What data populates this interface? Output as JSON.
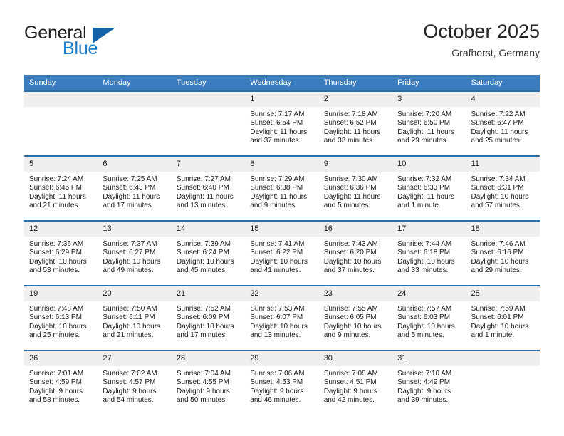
{
  "brand": {
    "line1": "General",
    "line2": "Blue",
    "logo_icon": "blue-triangle-logo",
    "color_dark": "#231f20",
    "color_blue": "#1e7bc4",
    "color_triangle": "#1462a5"
  },
  "header": {
    "title": "October 2025",
    "subtitle": "Grafhorst, Germany"
  },
  "theme": {
    "header_row_bg": "#3a7cbe",
    "row_border": "#2e6da4",
    "daynum_bg": "#efefef",
    "text": "#1a1a1a"
  },
  "weekday_headers": [
    "Sunday",
    "Monday",
    "Tuesday",
    "Wednesday",
    "Thursday",
    "Friday",
    "Saturday"
  ],
  "weeks": [
    [
      {
        "day": "",
        "sunrise": "",
        "sunset": "",
        "daylight": "",
        "empty": true
      },
      {
        "day": "",
        "sunrise": "",
        "sunset": "",
        "daylight": "",
        "empty": true
      },
      {
        "day": "",
        "sunrise": "",
        "sunset": "",
        "daylight": "",
        "empty": true
      },
      {
        "day": "1",
        "sunrise": "Sunrise: 7:17 AM",
        "sunset": "Sunset: 6:54 PM",
        "daylight": "Daylight: 11 hours and 37 minutes."
      },
      {
        "day": "2",
        "sunrise": "Sunrise: 7:18 AM",
        "sunset": "Sunset: 6:52 PM",
        "daylight": "Daylight: 11 hours and 33 minutes."
      },
      {
        "day": "3",
        "sunrise": "Sunrise: 7:20 AM",
        "sunset": "Sunset: 6:50 PM",
        "daylight": "Daylight: 11 hours and 29 minutes."
      },
      {
        "day": "4",
        "sunrise": "Sunrise: 7:22 AM",
        "sunset": "Sunset: 6:47 PM",
        "daylight": "Daylight: 11 hours and 25 minutes."
      }
    ],
    [
      {
        "day": "5",
        "sunrise": "Sunrise: 7:24 AM",
        "sunset": "Sunset: 6:45 PM",
        "daylight": "Daylight: 11 hours and 21 minutes."
      },
      {
        "day": "6",
        "sunrise": "Sunrise: 7:25 AM",
        "sunset": "Sunset: 6:43 PM",
        "daylight": "Daylight: 11 hours and 17 minutes."
      },
      {
        "day": "7",
        "sunrise": "Sunrise: 7:27 AM",
        "sunset": "Sunset: 6:40 PM",
        "daylight": "Daylight: 11 hours and 13 minutes."
      },
      {
        "day": "8",
        "sunrise": "Sunrise: 7:29 AM",
        "sunset": "Sunset: 6:38 PM",
        "daylight": "Daylight: 11 hours and 9 minutes."
      },
      {
        "day": "9",
        "sunrise": "Sunrise: 7:30 AM",
        "sunset": "Sunset: 6:36 PM",
        "daylight": "Daylight: 11 hours and 5 minutes."
      },
      {
        "day": "10",
        "sunrise": "Sunrise: 7:32 AM",
        "sunset": "Sunset: 6:33 PM",
        "daylight": "Daylight: 11 hours and 1 minute."
      },
      {
        "day": "11",
        "sunrise": "Sunrise: 7:34 AM",
        "sunset": "Sunset: 6:31 PM",
        "daylight": "Daylight: 10 hours and 57 minutes."
      }
    ],
    [
      {
        "day": "12",
        "sunrise": "Sunrise: 7:36 AM",
        "sunset": "Sunset: 6:29 PM",
        "daylight": "Daylight: 10 hours and 53 minutes."
      },
      {
        "day": "13",
        "sunrise": "Sunrise: 7:37 AM",
        "sunset": "Sunset: 6:27 PM",
        "daylight": "Daylight: 10 hours and 49 minutes."
      },
      {
        "day": "14",
        "sunrise": "Sunrise: 7:39 AM",
        "sunset": "Sunset: 6:24 PM",
        "daylight": "Daylight: 10 hours and 45 minutes."
      },
      {
        "day": "15",
        "sunrise": "Sunrise: 7:41 AM",
        "sunset": "Sunset: 6:22 PM",
        "daylight": "Daylight: 10 hours and 41 minutes."
      },
      {
        "day": "16",
        "sunrise": "Sunrise: 7:43 AM",
        "sunset": "Sunset: 6:20 PM",
        "daylight": "Daylight: 10 hours and 37 minutes."
      },
      {
        "day": "17",
        "sunrise": "Sunrise: 7:44 AM",
        "sunset": "Sunset: 6:18 PM",
        "daylight": "Daylight: 10 hours and 33 minutes."
      },
      {
        "day": "18",
        "sunrise": "Sunrise: 7:46 AM",
        "sunset": "Sunset: 6:16 PM",
        "daylight": "Daylight: 10 hours and 29 minutes."
      }
    ],
    [
      {
        "day": "19",
        "sunrise": "Sunrise: 7:48 AM",
        "sunset": "Sunset: 6:13 PM",
        "daylight": "Daylight: 10 hours and 25 minutes."
      },
      {
        "day": "20",
        "sunrise": "Sunrise: 7:50 AM",
        "sunset": "Sunset: 6:11 PM",
        "daylight": "Daylight: 10 hours and 21 minutes."
      },
      {
        "day": "21",
        "sunrise": "Sunrise: 7:52 AM",
        "sunset": "Sunset: 6:09 PM",
        "daylight": "Daylight: 10 hours and 17 minutes."
      },
      {
        "day": "22",
        "sunrise": "Sunrise: 7:53 AM",
        "sunset": "Sunset: 6:07 PM",
        "daylight": "Daylight: 10 hours and 13 minutes."
      },
      {
        "day": "23",
        "sunrise": "Sunrise: 7:55 AM",
        "sunset": "Sunset: 6:05 PM",
        "daylight": "Daylight: 10 hours and 9 minutes."
      },
      {
        "day": "24",
        "sunrise": "Sunrise: 7:57 AM",
        "sunset": "Sunset: 6:03 PM",
        "daylight": "Daylight: 10 hours and 5 minutes."
      },
      {
        "day": "25",
        "sunrise": "Sunrise: 7:59 AM",
        "sunset": "Sunset: 6:01 PM",
        "daylight": "Daylight: 10 hours and 1 minute."
      }
    ],
    [
      {
        "day": "26",
        "sunrise": "Sunrise: 7:01 AM",
        "sunset": "Sunset: 4:59 PM",
        "daylight": "Daylight: 9 hours and 58 minutes."
      },
      {
        "day": "27",
        "sunrise": "Sunrise: 7:02 AM",
        "sunset": "Sunset: 4:57 PM",
        "daylight": "Daylight: 9 hours and 54 minutes."
      },
      {
        "day": "28",
        "sunrise": "Sunrise: 7:04 AM",
        "sunset": "Sunset: 4:55 PM",
        "daylight": "Daylight: 9 hours and 50 minutes."
      },
      {
        "day": "29",
        "sunrise": "Sunrise: 7:06 AM",
        "sunset": "Sunset: 4:53 PM",
        "daylight": "Daylight: 9 hours and 46 minutes."
      },
      {
        "day": "30",
        "sunrise": "Sunrise: 7:08 AM",
        "sunset": "Sunset: 4:51 PM",
        "daylight": "Daylight: 9 hours and 42 minutes."
      },
      {
        "day": "31",
        "sunrise": "Sunrise: 7:10 AM",
        "sunset": "Sunset: 4:49 PM",
        "daylight": "Daylight: 9 hours and 39 minutes."
      },
      {
        "day": "",
        "sunrise": "",
        "sunset": "",
        "daylight": "",
        "empty": true
      }
    ]
  ]
}
